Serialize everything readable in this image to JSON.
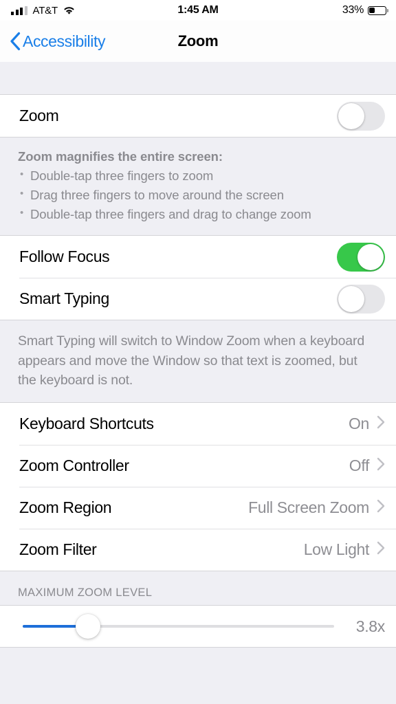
{
  "status_bar": {
    "carrier": "AT&T",
    "time": "1:45 AM",
    "battery_percent": "33%",
    "battery_level": 33,
    "signal_bars_filled": 3,
    "signal_bars_total": 4,
    "wifi_icon": "wifi-icon"
  },
  "nav": {
    "back_label": "Accessibility",
    "back_icon": "chevron-left-icon",
    "title": "Zoom"
  },
  "zoom_section": {
    "rows": [
      {
        "label": "Zoom",
        "toggle": "off"
      }
    ],
    "footer_title": "Zoom magnifies the entire screen:",
    "footer_bullets": [
      "Double-tap three fingers to zoom",
      "Drag three fingers to move around the screen",
      "Double-tap three fingers and drag to change zoom"
    ]
  },
  "focus_section": {
    "rows": [
      {
        "label": "Follow Focus",
        "toggle": "on"
      },
      {
        "label": "Smart Typing",
        "toggle": "off"
      }
    ],
    "footer_text": "Smart Typing will switch to Window Zoom when a keyboard appears and move the Window so that text is zoomed, but the keyboard is not."
  },
  "options_section": {
    "rows": [
      {
        "label": "Keyboard Shortcuts",
        "value": "On"
      },
      {
        "label": "Zoom Controller",
        "value": "Off"
      },
      {
        "label": "Zoom Region",
        "value": "Full Screen Zoom"
      },
      {
        "label": "Zoom Filter",
        "value": "Low Light"
      }
    ]
  },
  "max_zoom_section": {
    "header": "MAXIMUM ZOOM LEVEL",
    "value_label": "3.8x",
    "slider_percent": 21
  },
  "colors": {
    "accent_blue": "#1a7fe8",
    "toggle_on_green": "#37c84a",
    "slider_blue": "#1e6fd9",
    "secondary_text": "#8e8e93",
    "group_background": "#efeff4"
  }
}
